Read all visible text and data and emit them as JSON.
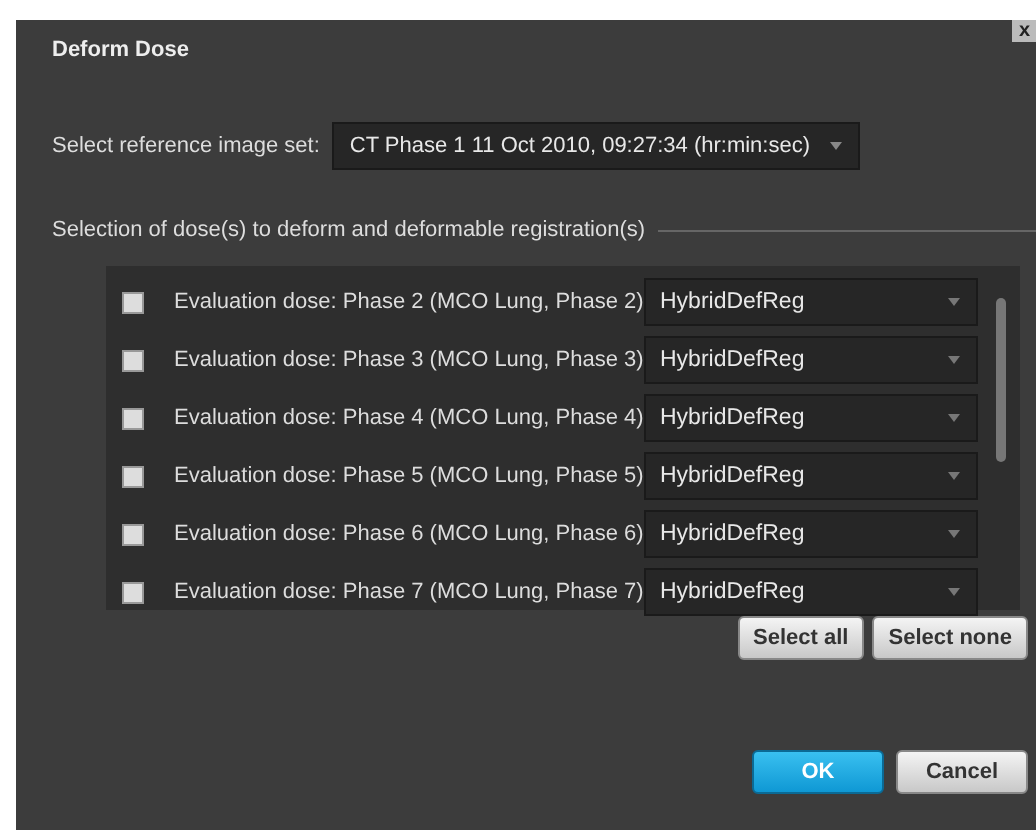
{
  "window": {
    "title": "Deform Dose",
    "close": "x"
  },
  "reference": {
    "label": "Select reference image set:",
    "value": "CT Phase 1 11 Oct 2010, 09:27:34 (hr:min:sec)"
  },
  "section": {
    "title": "Selection of dose(s) to deform and deformable registration(s)"
  },
  "doses": [
    {
      "label": "Evaluation dose: Phase 2 (MCO Lung, Phase 2)",
      "checked": false,
      "registration": "HybridDefReg"
    },
    {
      "label": "Evaluation dose: Phase 3 (MCO Lung, Phase 3)",
      "checked": false,
      "registration": "HybridDefReg"
    },
    {
      "label": "Evaluation dose: Phase 4 (MCO Lung, Phase 4)",
      "checked": false,
      "registration": "HybridDefReg"
    },
    {
      "label": "Evaluation dose: Phase 5 (MCO Lung, Phase 5)",
      "checked": false,
      "registration": "HybridDefReg"
    },
    {
      "label": "Evaluation dose: Phase 6 (MCO Lung, Phase 6)",
      "checked": false,
      "registration": "HybridDefReg"
    },
    {
      "label": "Evaluation dose: Phase 7 (MCO Lung, Phase 7)",
      "checked": false,
      "registration": "HybridDefReg"
    }
  ],
  "selection_buttons": [
    "Select all",
    "Select none"
  ],
  "buttons": [
    {
      "label": "OK",
      "kind": "primary"
    },
    {
      "label": "Cancel",
      "kind": "secondary"
    }
  ]
}
